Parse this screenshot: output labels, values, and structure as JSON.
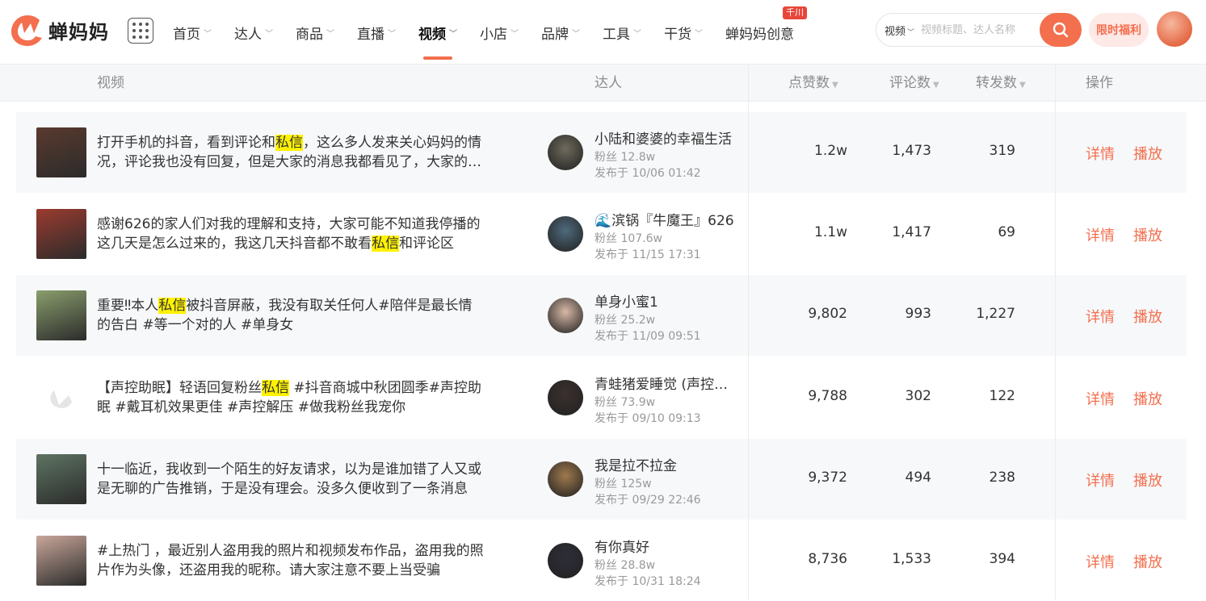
{
  "brand": {
    "name": "蝉妈妈",
    "accent": "#f36f4e",
    "highlight": "#fff200"
  },
  "nav": {
    "items": [
      {
        "label": "首页",
        "chevron": true
      },
      {
        "label": "达人",
        "chevron": true
      },
      {
        "label": "商品",
        "chevron": true
      },
      {
        "label": "直播",
        "chevron": true
      },
      {
        "label": "视频",
        "chevron": true,
        "active": true
      },
      {
        "label": "小店",
        "chevron": true
      },
      {
        "label": "品牌",
        "chevron": true
      },
      {
        "label": "工具",
        "chevron": true
      },
      {
        "label": "干货",
        "chevron": true
      },
      {
        "label": "蝉妈妈创意",
        "chevron": false,
        "badge": "千川"
      }
    ]
  },
  "search": {
    "type_label": "视频",
    "placeholder": "视频标题、达人名称"
  },
  "promo_label": "限时福利",
  "table": {
    "headers": {
      "video": "视频",
      "creator": "达人",
      "likes": "点赞数",
      "comments": "评论数",
      "shares": "转发数",
      "actions": "操作"
    },
    "action_labels": {
      "detail": "详情",
      "play": "播放"
    },
    "rows": [
      {
        "title_parts": [
          "打开手机的抖音，看到评论和",
          "私信",
          "，这么多人发来关心妈妈的情况，评论我也没有回复，但是大家的消息我都看见了，大家的关心我都收到了"
        ],
        "creator": "小陆和婆婆的幸福生活",
        "fans": "粉丝 12.8w",
        "date": "发布于 10/06 01:42",
        "likes": "1.2w",
        "comments": "1,473",
        "shares": "319",
        "thumb_color": "#5a3a2e",
        "avatar_color": "#6f6a5c"
      },
      {
        "title_parts": [
          "感谢626的家人们对我的理解和支持，大家可能不知道我停播的这几天是怎么过来的，我这几天抖音都不敢看",
          "私信",
          "和评论区"
        ],
        "creator": "🌊滨锅『牛魔王』626",
        "fans": "粉丝 107.6w",
        "date": "发布于 11/15 17:31",
        "likes": "1.1w",
        "comments": "1,417",
        "shares": "69",
        "thumb_color": "#9b3b2f",
        "avatar_color": "#4f6a7d"
      },
      {
        "title_parts": [
          "重要‼本人",
          "私信",
          "被抖音屏蔽，我没有取关任何人#陪伴是最长情的告白 #等一个对的人 #单身女"
        ],
        "creator": "单身小蜜1",
        "fans": "粉丝 25.2w",
        "date": "发布于 11/09 09:51",
        "likes": "9,802",
        "comments": "993",
        "shares": "1,227",
        "thumb_color": "#8a9e6c",
        "avatar_color": "#d8b8a6"
      },
      {
        "title_parts": [
          "【声控助眠】轻语回复粉丝",
          "私信",
          " #抖音商城中秋团圆季#声控助眠 #戴耳机效果更佳 #声控解压 #做我粉丝我宠你"
        ],
        "creator": "青蛙猪爱睡觉 (声控助眠)",
        "fans": "粉丝 73.9w",
        "date": "发布于 09/10 09:13",
        "likes": "9,788",
        "comments": "302",
        "shares": "122",
        "thumb_color": "placeholder",
        "avatar_color": "#3b302e"
      },
      {
        "title_parts": [
          "十一临近，我收到一个陌生的好友请求，以为是谁加错了人又或是无聊的广告推销，于是没有理会。没多久便收到了一条消息"
        ],
        "creator": "我是拉不拉金",
        "fans": "粉丝 125w",
        "date": "发布于 09/29 22:46",
        "likes": "9,372",
        "comments": "494",
        "shares": "238",
        "thumb_color": "#5e7463",
        "avatar_color": "#a07a4e"
      },
      {
        "title_parts": [
          "#上热门 ，最近别人盗用我的照片和视频发布作品，盗用我的照片作为头像，还盗用我的昵称。请大家注意不要上当受骗"
        ],
        "creator": "有你真好",
        "fans": "粉丝 28.8w",
        "date": "发布于 10/31 18:24",
        "likes": "8,736",
        "comments": "1,533",
        "shares": "394",
        "thumb_color": "#c9a79a",
        "avatar_color": "#2e2e3a"
      }
    ]
  }
}
